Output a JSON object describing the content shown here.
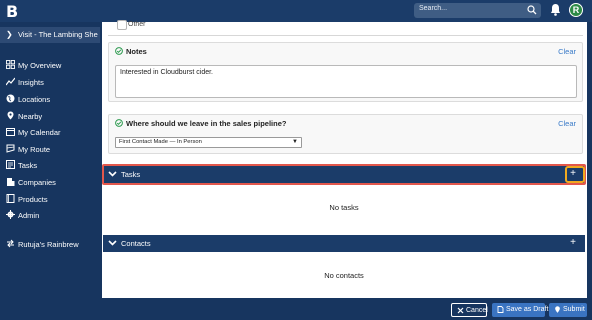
{
  "app": {
    "logo_letter": "B",
    "avatar_initial": "R"
  },
  "search": {
    "placeholder": "Search..."
  },
  "sidebar": {
    "visit_label": "Visit - The Lambing She...",
    "items": [
      {
        "label": "My Overview",
        "icon": "grid-icon"
      },
      {
        "label": "Insights",
        "icon": "trend-icon"
      },
      {
        "label": "Locations",
        "icon": "globe-icon"
      },
      {
        "label": "Nearby",
        "icon": "pin-icon"
      },
      {
        "label": "My Calendar",
        "icon": "calendar-icon"
      },
      {
        "label": "My Route",
        "icon": "route-icon"
      },
      {
        "label": "Tasks",
        "icon": "tasks-icon"
      },
      {
        "label": "Companies",
        "icon": "building-icon"
      },
      {
        "label": "Products",
        "icon": "book-icon"
      },
      {
        "label": "Admin",
        "icon": "gear-icon"
      }
    ],
    "brand_switch": "Rutuja's Rainbrew"
  },
  "form": {
    "other_option": "Other",
    "notes": {
      "title": "Notes",
      "clear": "Clear",
      "value": "Interested in Cloudburst cider."
    },
    "pipeline": {
      "title": "Where should we leave in the sales pipeline?",
      "clear": "Clear",
      "selected": "First Contact Made — In Person"
    }
  },
  "tasks": {
    "title": "Tasks",
    "empty": "No tasks",
    "add": "+"
  },
  "contacts": {
    "title": "Contacts",
    "empty": "No contacts",
    "add": "+"
  },
  "actions": {
    "cancel": "Cancel",
    "draft": "Save as Draft",
    "submit": "Submit"
  },
  "colors": {
    "navy": "#1b3c69",
    "accent_blue": "#3a74c2",
    "highlight_red": "#e2574c",
    "highlight_orange": "#f0a91f",
    "check_green": "#2d9a4f"
  }
}
